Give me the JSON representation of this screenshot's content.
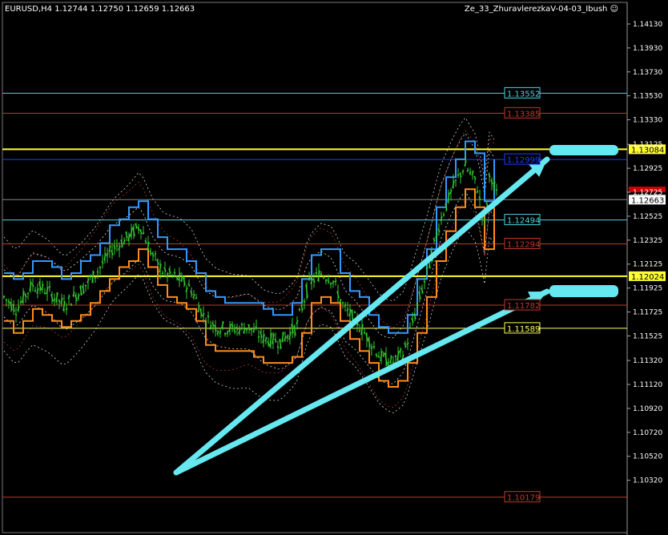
{
  "window": {
    "symbol_info": "EURUSD,H4  1.12744 1.12750 1.12659 1.12663",
    "indicator_label": "Ze_33_ZhuravlerezkaV-04-03_Ibush"
  },
  "price_axis": {
    "min": 1.1003,
    "max": 1.1423,
    "ticks": [
      "1.14130",
      "1.13930",
      "1.13730",
      "1.13530",
      "1.13330",
      "1.13125",
      "1.12925",
      "1.12725",
      "1.12525",
      "1.12325",
      "1.12125",
      "1.11925",
      "1.11725",
      "1.11525",
      "1.11320",
      "1.11120",
      "1.10920",
      "1.10720",
      "1.10520",
      "1.10320"
    ]
  },
  "levels": [
    {
      "label": "1.13552",
      "price": 1.13552,
      "color": "#4fd3e0",
      "axis": false
    },
    {
      "label": "1.13385",
      "price": 1.13385,
      "color": "#c0392b",
      "axis": false
    },
    {
      "label": "1.13084",
      "price": 1.13084,
      "color": "#ffff33",
      "axis": true
    },
    {
      "label": "1.12999",
      "price": 1.12999,
      "color": "#1f3cff",
      "axis": false
    },
    {
      "label": "1.12663",
      "price": 1.12663,
      "color": "#ffffff",
      "axis": true
    },
    {
      "label": "1.12494",
      "price": 1.12494,
      "color": "#4fd3e0",
      "axis": false
    },
    {
      "label": "1.12294",
      "price": 1.12294,
      "color": "#c0392b",
      "axis": false
    },
    {
      "label": "1.12024",
      "price": 1.12024,
      "color": "#ffff33",
      "axis": true
    },
    {
      "label": "1.11782",
      "price": 1.11782,
      "color": "#c0392b",
      "axis": false
    },
    {
      "label": "1.11589",
      "price": 1.11589,
      "color": "#ffff66",
      "axis": false
    },
    {
      "label": "1.10179",
      "price": 1.10179,
      "color": "#c0392b",
      "axis": false
    }
  ],
  "colors": {
    "background": "#000000",
    "candles": "#33cc33",
    "cyan_channel": "#3399ff",
    "orange_channel": "#ff8c1a",
    "arrows": "#66e8f0",
    "bid_marker": "#cc0000"
  },
  "icons": [
    "smiley-icon"
  ]
}
